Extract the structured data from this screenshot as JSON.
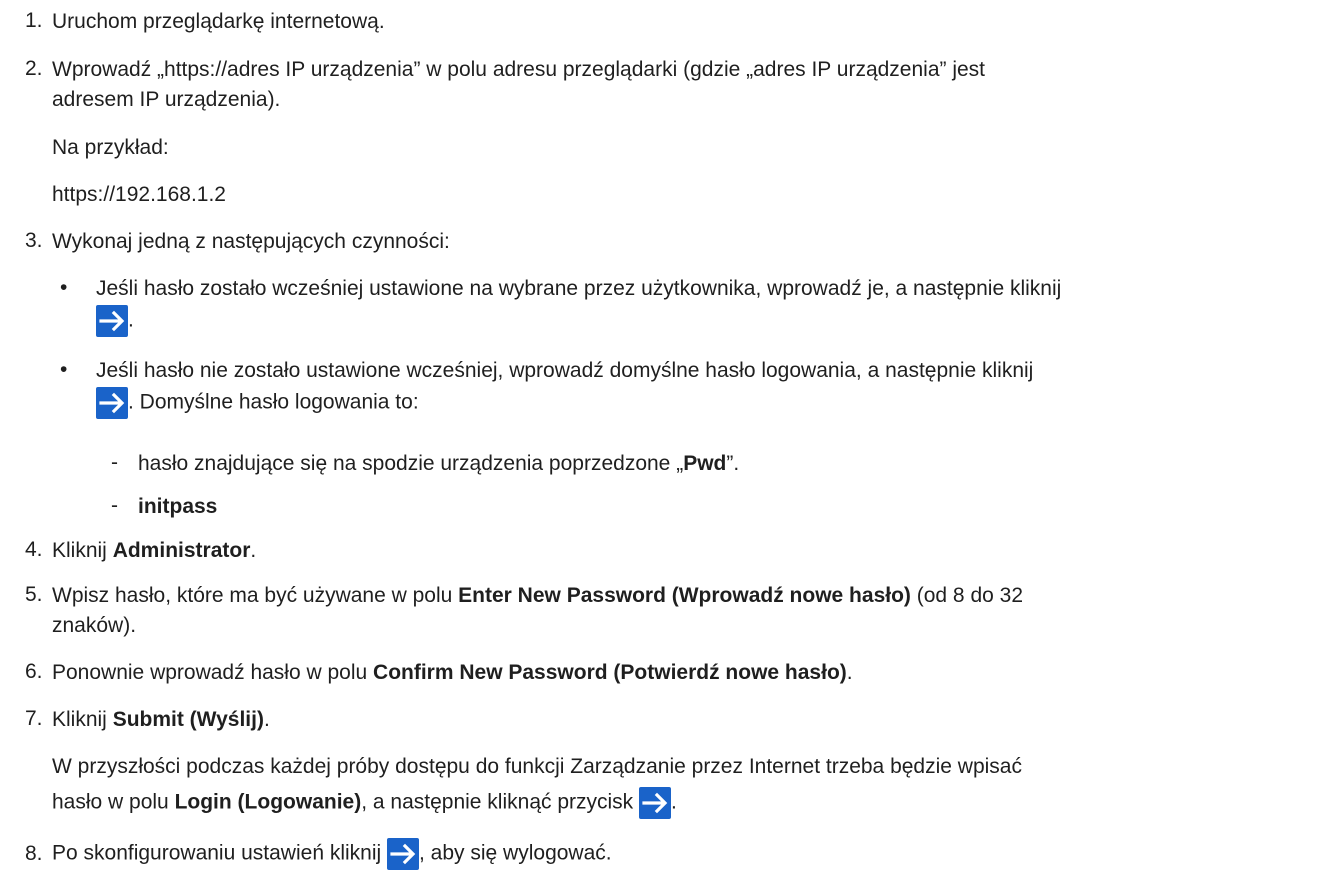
{
  "steps": {
    "s1": {
      "num": "1.",
      "text": "Uruchom przeglądarkę internetową."
    },
    "s2": {
      "num": "2.",
      "line1": "Wprowadź „https://adres IP urządzenia” w polu adresu przeglądarki (gdzie „adres IP urządzenia” jest",
      "line2": "adresem IP urządzenia).",
      "example_label": "Na przykład:",
      "example_url": "https://192.168.1.2"
    },
    "s3": {
      "num": "3.",
      "text": "Wykonaj jedną z następujących czynności:",
      "b1_line1": "Jeśli hasło zostało wcześniej ustawione na wybrane przez użytkownika, wprowadź je, a następnie kliknij",
      "b1_tail": ".",
      "b2_line1": "Jeśli hasło nie zostało ustawione wcześniej, wprowadź domyślne hasło logowania, a następnie kliknij",
      "b2_tail": ". Domyślne hasło logowania to:",
      "d1_pre": "hasło znajdujące się na spodzie urządzenia poprzedzone „",
      "d1_bold": "Pwd",
      "d1_post": "”.",
      "d2_bold": "initpass",
      "bullet": "•",
      "dash": "-"
    },
    "s4": {
      "num": "4.",
      "pre": "Kliknij ",
      "bold": "Administrator",
      "post": "."
    },
    "s5": {
      "num": "5.",
      "pre": "Wpisz hasło, które ma być używane w polu ",
      "bold": "Enter New Password (Wprowadź nowe hasło)",
      "post": " (od 8 do 32",
      "line2": "znaków)."
    },
    "s6": {
      "num": "6.",
      "pre": "Ponownie wprowadź hasło w polu ",
      "bold": "Confirm New Password (Potwierdź nowe hasło)",
      "post": "."
    },
    "s7": {
      "num": "7.",
      "pre": "Kliknij ",
      "bold": "Submit (Wyślij)",
      "post": ".",
      "note_line1": "W przyszłości podczas każdej próby dostępu do funkcji Zarządzanie przez Internet trzeba będzie wpisać",
      "note_pre": "hasło w polu ",
      "note_bold": "Login (Logowanie)",
      "note_post": ", a następnie kliknąć przycisk ",
      "note_tail": "."
    },
    "s8": {
      "num": "8.",
      "pre": "Po skonfigurowaniu ustawień kliknij ",
      "post": ", aby się wylogować."
    }
  },
  "icons": {
    "arrow": "arrow-right-icon",
    "color": "#1a63c9"
  }
}
